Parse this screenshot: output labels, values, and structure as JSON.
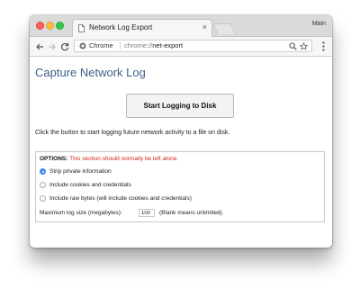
{
  "browser": {
    "tab_title": "Network Log Export",
    "profile_name": "Main",
    "omnibox": {
      "security_label": "Chrome",
      "url_scheme": "chrome://",
      "url_host": "net-export"
    }
  },
  "page": {
    "title": "Capture Network Log",
    "start_button_label": "Start Logging to Disk",
    "description": "Click the button to start logging future network activity to a file on disk.",
    "options": {
      "heading": "OPTIONS:",
      "warning": "This section should normally be left alone.",
      "radio_options": [
        {
          "label": "Strip private information",
          "selected": true
        },
        {
          "label": "Include cookies and credentials",
          "selected": false
        },
        {
          "label": "Include raw bytes (will include cookies and credentials)",
          "selected": false
        }
      ],
      "max_size_label": "Maximum log size (megabytes):",
      "max_size_value": "100",
      "max_size_hint": "(Blank means unlimited)."
    }
  },
  "colors": {
    "title_blue": "#3c6189",
    "warning_red": "#d21f1f",
    "radio_selected": "#3b86f7"
  }
}
